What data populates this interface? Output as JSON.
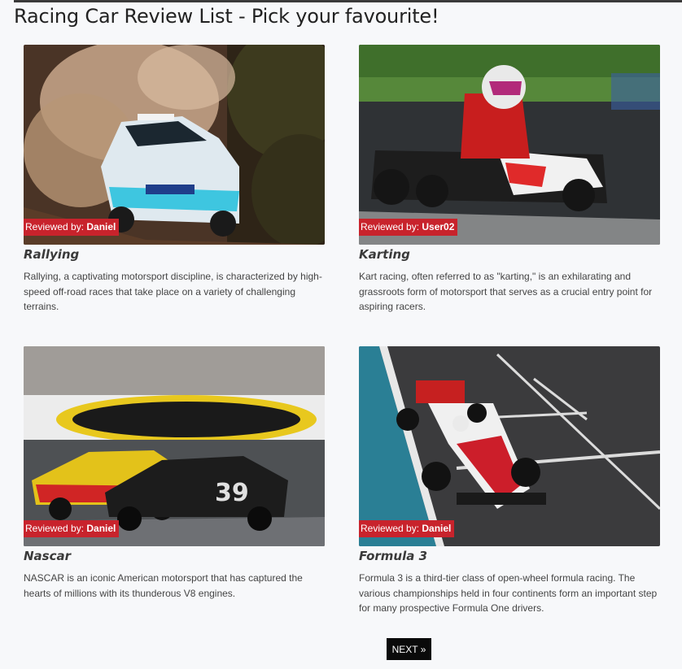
{
  "page": {
    "title": "Racing Car Review List - Pick your favourite!",
    "next_label": "NEXT »"
  },
  "colors": {
    "badge": "#c8232c",
    "button": "#0a0a0a"
  },
  "reviews": [
    {
      "title": "Rallying",
      "badge_prefix": "Reviewed by: ",
      "reviewer": "Daniel",
      "description": "Rallying, a captivating motorsport discipline, is characterized by high-speed off-road races that take place on a variety of challenging terrains.",
      "image": "rally-car-photo"
    },
    {
      "title": "Karting",
      "badge_prefix": "Reviewed by: ",
      "reviewer": "User02",
      "description": "Kart racing, often referred to as \"karting,\" is an exhilarating and grassroots form of motorsport that serves as a crucial entry point for aspiring racers.",
      "image": "kart-racing-photo"
    },
    {
      "title": "Nascar",
      "badge_prefix": "Reviewed by: ",
      "reviewer": "Daniel",
      "description": "NASCAR is an iconic American motorsport that has captured the hearts of millions with its thunderous V8 engines.",
      "image": "nascar-photo"
    },
    {
      "title": "Formula 3",
      "badge_prefix": "Reviewed by: ",
      "reviewer": "Daniel",
      "description": "Formula 3 is a third-tier class of open-wheel formula racing. The various championships held in four continents form an important step for many prospective Formula One drivers.",
      "image": "formula-3-photo"
    }
  ]
}
